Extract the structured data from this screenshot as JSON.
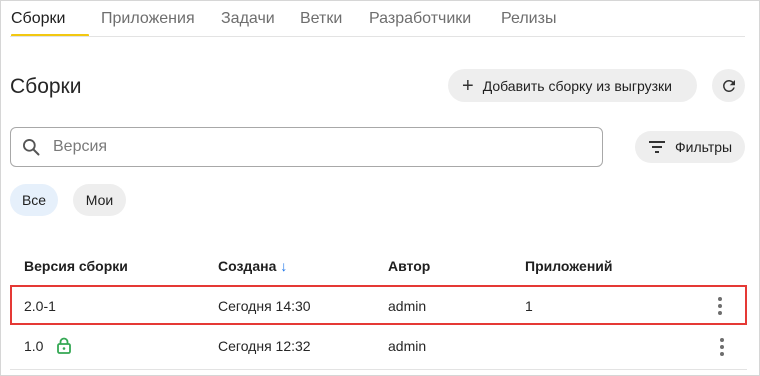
{
  "tabs": [
    {
      "label": "Сборки",
      "active": true
    },
    {
      "label": "Приложения"
    },
    {
      "label": "Задачи"
    },
    {
      "label": "Ветки"
    },
    {
      "label": "Разработчики"
    },
    {
      "label": "Релизы"
    }
  ],
  "header": {
    "title": "Сборки",
    "add_button_label": "Добавить сборку из выгрузки",
    "refresh_icon": "refresh-icon"
  },
  "search": {
    "placeholder": "Версия",
    "value": "",
    "icon": "search-icon"
  },
  "filters": {
    "label": "Фильтры",
    "icon": "filter-icon"
  },
  "chips": [
    {
      "label": "Все",
      "selected": true
    },
    {
      "label": "Мои",
      "selected": false
    }
  ],
  "table": {
    "columns": [
      "Версия сборки",
      "Создана",
      "Автор",
      "Приложений"
    ],
    "sort": {
      "column": "Создана",
      "direction": "desc",
      "icon": "arrow-down-icon"
    },
    "rows": [
      {
        "version": "2.0-1",
        "created": "Сегодня 14:30",
        "author": "admin",
        "apps": "1",
        "locked": false,
        "highlighted": true
      },
      {
        "version": "1.0",
        "created": "Сегодня 12:32",
        "author": "admin",
        "apps": "",
        "locked": true,
        "highlighted": false
      }
    ]
  },
  "colors": {
    "accent_underline": "#f2c811",
    "sort_arrow": "#1a73e8",
    "lock_icon": "#34a853",
    "highlight_border": "#e53935",
    "chip_selected_bg": "#e6f0fb"
  }
}
